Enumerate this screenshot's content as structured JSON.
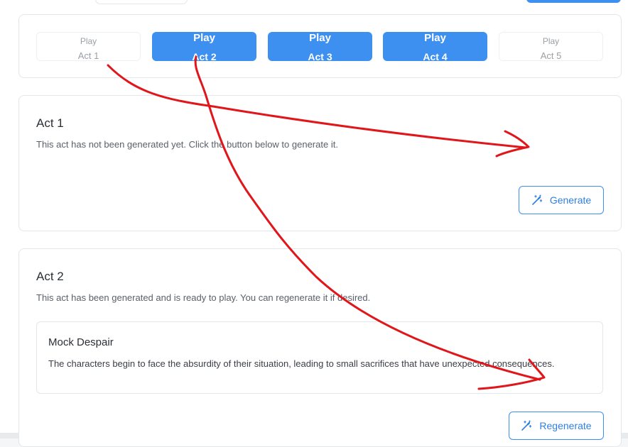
{
  "acts_bar": {
    "tabs": [
      {
        "play_label": "Play",
        "act_label": "Act 1",
        "state": "disabled"
      },
      {
        "play_label": "Play",
        "act_label": "Act 2",
        "state": "active"
      },
      {
        "play_label": "Play",
        "act_label": "Act 3",
        "state": "active"
      },
      {
        "play_label": "Play",
        "act_label": "Act 4",
        "state": "active"
      },
      {
        "play_label": "Play",
        "act_label": "Act 5",
        "state": "disabled"
      }
    ]
  },
  "act1": {
    "title": "Act 1",
    "description": "This act has not been generated yet. Click the button below to generate it.",
    "button_label": "Generate",
    "button_icon": "magic-wand-icon"
  },
  "act2": {
    "title": "Act 2",
    "description": "This act has been generated and is ready to play. You can regenerate it if desired.",
    "content_title": "Mock Despair",
    "content_text": "The characters begin to face the absurdity of their situation, leading to small sacrifices that have unexpected consequences.",
    "button_label": "Regenerate",
    "button_icon": "magic-wand-icon"
  },
  "colors": {
    "accent": "#3d8ff0",
    "annotation_red": "#e0161b"
  }
}
